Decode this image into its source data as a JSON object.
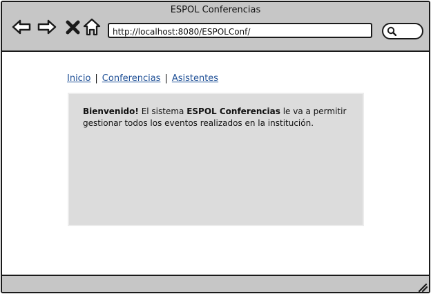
{
  "window": {
    "title": "ESPOL Conferencias"
  },
  "toolbar": {
    "back_icon": "back-arrow-icon",
    "forward_icon": "forward-arrow-icon",
    "stop_icon": "close-icon",
    "home_icon": "home-icon",
    "url": "http://localhost:8080/ESPOLConf/",
    "search_icon": "search-icon"
  },
  "nav": {
    "items": [
      {
        "label": "Inicio"
      },
      {
        "label": "Conferencias"
      },
      {
        "label": "Asistentes"
      }
    ],
    "separator": "|"
  },
  "welcome": {
    "greeting": "Bienvenido!",
    "text1": " El sistema ",
    "system_name": "ESPOL Conferencias",
    "text2": " le va a permitir gestionar todos los eventos realizados en la institución."
  },
  "colors": {
    "chrome": "#c6c6c6",
    "panel": "#dcdcdc",
    "link": "#1e4f96",
    "border": "#1a1a1a"
  }
}
